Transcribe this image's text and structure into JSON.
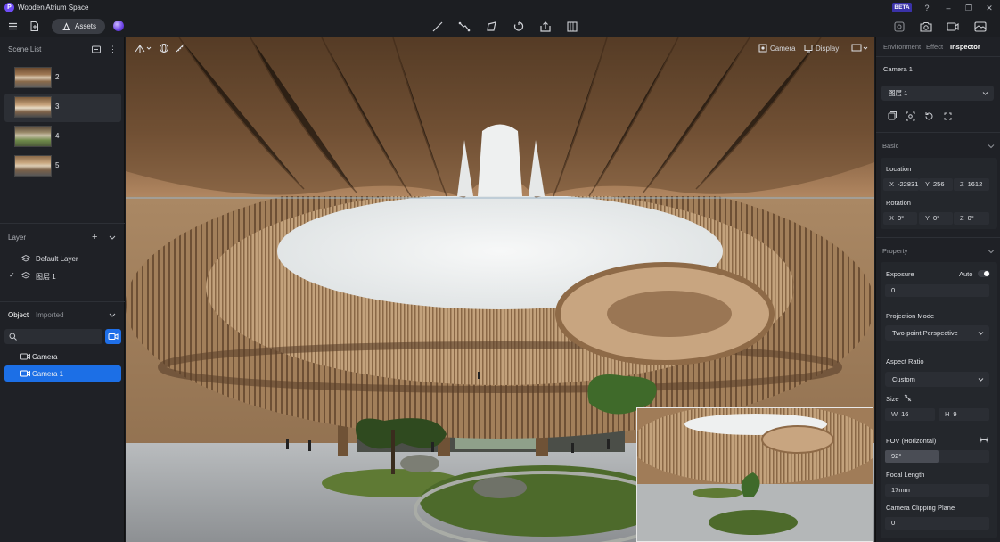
{
  "app": {
    "title": "Wooden Atrium Space",
    "logo_letter": "P",
    "beta": "BETA"
  },
  "toolbar": {
    "assets_label": "Assets",
    "draw_tools": [
      "line-tool-icon",
      "polyline-tool-icon",
      "polygon-tool-icon",
      "lasso-tool-icon",
      "export-tool-icon",
      "grid-tool-icon"
    ],
    "right_tools": [
      "vr-icon",
      "screenshot-icon",
      "video-icon",
      "panorama-icon"
    ]
  },
  "scene_list": {
    "title": "Scene List",
    "items": [
      {
        "label": "2",
        "selected": false
      },
      {
        "label": "3",
        "selected": true
      },
      {
        "label": "4",
        "selected": false
      },
      {
        "label": "5",
        "selected": false
      }
    ]
  },
  "layer": {
    "title": "Layer",
    "items": [
      {
        "label": "Default Layer",
        "checked": false
      },
      {
        "label": "图层 1",
        "checked": true
      }
    ]
  },
  "object": {
    "tabs": [
      "Object",
      "Imported"
    ],
    "active_tab": "Object",
    "search_value": "",
    "items": [
      {
        "label": "Camera",
        "selected": false
      },
      {
        "label": "Camera 1",
        "selected": true
      }
    ]
  },
  "viewport": {
    "camera_label": "Camera",
    "display_label": "Display"
  },
  "inspector": {
    "tabs": [
      "Environment",
      "Effect",
      "Inspector"
    ],
    "active_tab": "Inspector",
    "object_name": "Camera 1",
    "layer_select": "图层 1",
    "basic": {
      "title": "Basic",
      "location_label": "Location",
      "location": {
        "x": "-22831",
        "y": "256",
        "z": "1612"
      },
      "rotation_label": "Rotation",
      "rotation": {
        "x": "0°",
        "y": "0°",
        "z": "0°"
      }
    },
    "property": {
      "title": "Property",
      "exposure_label": "Exposure",
      "auto_label": "Auto",
      "auto_on": true,
      "exposure_value": "0",
      "projection_label": "Projection Mode",
      "projection_value": "Two-point Perspective",
      "aspect_label": "Aspect Ratio",
      "aspect_value": "Custom",
      "size_label": "Size",
      "size_w": "16",
      "size_h": "9",
      "fov_label": "FOV (Horizontal)",
      "fov_value": "92°",
      "fov_fraction": 0.51,
      "focal_label": "Focal Length",
      "focal_value": "17mm",
      "clipping_label": "Camera Clipping Plane",
      "clipping_value": "0"
    }
  },
  "colors": {
    "accent": "#1c6fe6",
    "bg": "#1a1c20",
    "panel": "#1f2126",
    "beta": "#3a32a8"
  }
}
